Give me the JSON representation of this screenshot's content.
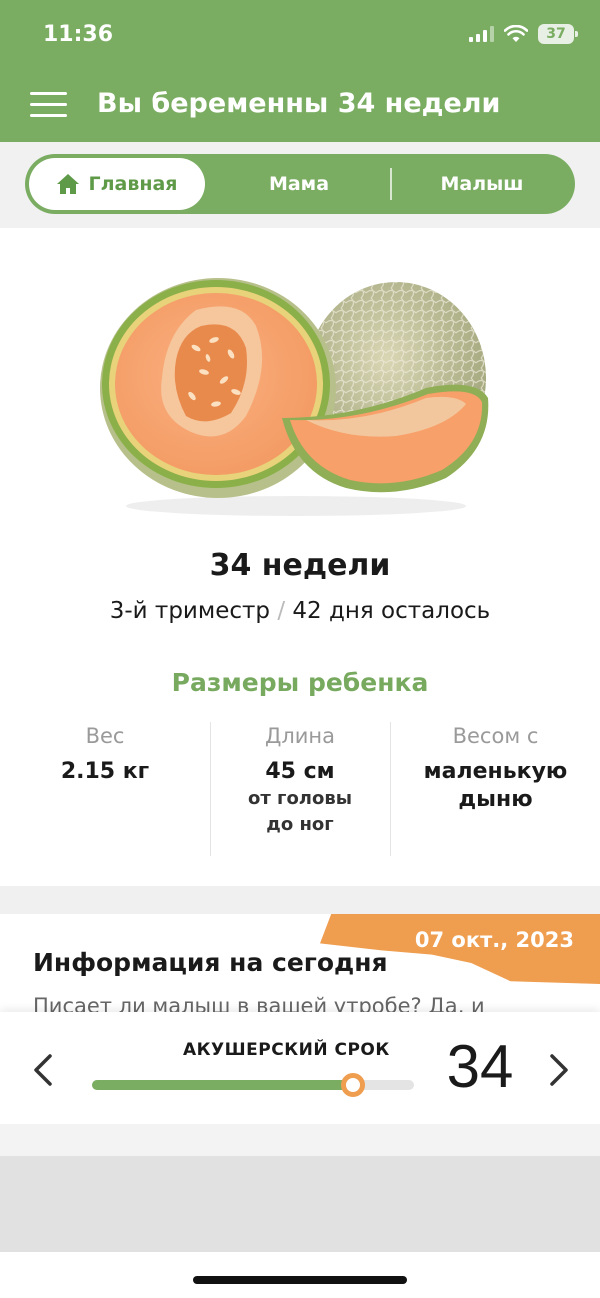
{
  "status": {
    "time": "11:36",
    "battery": "37"
  },
  "header": {
    "title": "Вы беременны 34 недели",
    "menu_icon": "hamburger-menu-icon"
  },
  "tabs": [
    {
      "label": "Главная",
      "icon": "home-icon",
      "active": true
    },
    {
      "label": "Мама",
      "active": false
    },
    {
      "label": "Малыш",
      "active": false
    }
  ],
  "hero": {
    "image": "cantaloupe-melon",
    "week_title": "34 недели",
    "trimester": "3-й триместр",
    "separator": "/",
    "remaining": "42 дня осталось"
  },
  "sizes": {
    "title": "Размеры ребенка",
    "weight": {
      "label": "Вес",
      "value": "2.15 кг"
    },
    "length": {
      "label": "Длина",
      "value": "45 см",
      "sub_line1": "от головы",
      "sub_line2": "до ног"
    },
    "compare": {
      "label": "Весом с",
      "value_line1": "маленькую",
      "value_line2": "дыню"
    }
  },
  "info": {
    "date": "07 окт., 2023",
    "title": "Информация на сегодня",
    "text": "Писает ли малыш в вашей утробе? Да, и"
  },
  "term": {
    "label": "АКУШЕРСКИЙ СРОК",
    "week": "34",
    "progress": 0.81
  },
  "colors": {
    "brand_green": "#7aad62",
    "accent_orange": "#ef9d4f"
  }
}
